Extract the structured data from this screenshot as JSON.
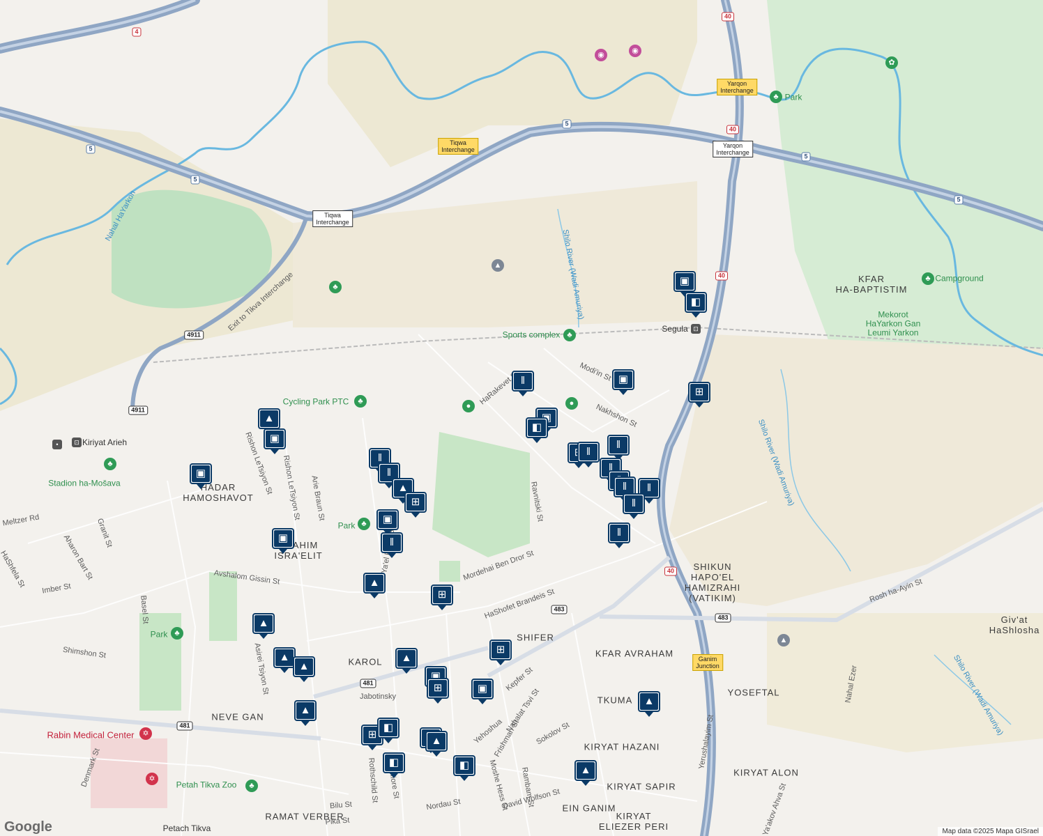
{
  "attribution": "Map data ©2025 Mapa GISrael",
  "logo": "Google",
  "colors": {
    "highway": "#8fa6c4",
    "green": "#cfe8cf",
    "water": "#69b8e0",
    "pin": "#0b3a66",
    "land": "#f3f1ed"
  },
  "neighborhoods": [
    {
      "text": "HADAR\nHAMOSHAVOT"
    },
    {
      "text": "HAAHIM\nISRA'ELIT"
    },
    {
      "text": "KAROL"
    },
    {
      "text": "SHIFER"
    },
    {
      "text": "NEVE GAN"
    },
    {
      "text": "KFAR AVRAHAM"
    },
    {
      "text": "TKUMA"
    },
    {
      "text": "YOSEFTAL"
    },
    {
      "text": "KIRYAT HAZANI"
    },
    {
      "text": "KIRYAT ALON"
    },
    {
      "text": "KIRYAT SAPIR"
    },
    {
      "text": "EIN GANIM"
    },
    {
      "text": "RAMAT VERBER"
    },
    {
      "text": "KIRYAT\nELIEZER PERI"
    },
    {
      "text": "SHIKUN\nHAPO'EL\nHAMIZRAHI\n(VATIKIM)"
    },
    {
      "text": "KFAR\nHA-BAPTISTIM"
    },
    {
      "text": "Giv'at\nHaShlosha"
    }
  ],
  "streets": [
    "Rishon LeTsiyon St",
    "Arie Braun St",
    "Mordehai Ben Dror St",
    "Ravnitski St",
    "HaShofet Brandeis St",
    "Avshalom Gissin St",
    "Imber St",
    "Aharon Bart St",
    "Granit St",
    "Basel St",
    "Shimshon St",
    "Asirei Tsiyon St",
    "Nakhshon St",
    "Modi'in St",
    "HaRakevet St",
    "Rosh ha-Ayin St",
    "Yerushalayim St",
    "Sokolov St",
    "Rambam St",
    "Nahalat Tsvi St",
    "Frishman St",
    "Moshe Hess St",
    "David Wolfson St",
    "Nordau St",
    "Pika St",
    "Bilu St",
    "Rothschild St",
    "Montefiore St",
    "Denmark St",
    "Ya'akov Ahva St",
    "Nahal Ezer",
    "Exit to Tikva Interchange",
    "Ya'el Ro'itz St",
    "Rishon LeTsiyon St",
    "Jabotinsky",
    "Yehoshua",
    "Kepfer St",
    "Meltzer Rd",
    "HaShfela St"
  ],
  "water_labels": [
    "Nahal HaYarkon",
    "Shilo River (Wadi Amuriya)",
    "Shilo River (Wadi Amuriya)",
    "Shilo River (Wadi Amuriya)"
  ],
  "places": {
    "green": [
      "Cycling Park PTC",
      "Sports complex",
      "Park",
      "Park",
      "Park",
      "Petah Tikva Zoo",
      "Stadion ha-Mošava",
      "Campground",
      "Mekorot\nHaYarkon Gan\nLeumi Yarkon"
    ],
    "red": [
      "Rabin Medical Center"
    ],
    "dark": [
      "Kiriyat Arieh",
      "Segula",
      "Petach Tikva"
    ]
  },
  "interchanges": [
    "Tiqwa\nInterchange",
    "Tiqwa\nInterchange",
    "Yarqon\nInterchange",
    "Yarqon\nInterchange",
    "Ganim\nJunction"
  ],
  "shields": [
    "4",
    "5",
    "5",
    "5",
    "5",
    "5",
    "40",
    "40",
    "40",
    "40",
    "4911",
    "4911",
    "481",
    "481",
    "483",
    "483"
  ],
  "pins": [
    {
      "icon": "restaurant"
    },
    {
      "icon": "shopping"
    },
    {
      "icon": "shopping"
    },
    {
      "icon": "cafe"
    },
    {
      "icon": "grocery"
    },
    {
      "icon": "shopping"
    },
    {
      "icon": "cafe"
    },
    {
      "icon": "grocery"
    },
    {
      "icon": "restaurant"
    },
    {
      "icon": "restaurant"
    },
    {
      "icon": "restaurant"
    },
    {
      "icon": "restaurant"
    },
    {
      "icon": "restaurant"
    },
    {
      "icon": "restaurant"
    },
    {
      "icon": "restaurant"
    },
    {
      "icon": "school"
    },
    {
      "icon": "shopping"
    },
    {
      "icon": "shopping"
    },
    {
      "icon": "shopping"
    },
    {
      "icon": "restaurant"
    },
    {
      "icon": "restaurant"
    },
    {
      "icon": "school"
    },
    {
      "icon": "grocery"
    },
    {
      "icon": "shopping"
    },
    {
      "icon": "restaurant"
    },
    {
      "icon": "school"
    },
    {
      "icon": "grocery"
    },
    {
      "icon": "school"
    },
    {
      "icon": "school"
    },
    {
      "icon": "school"
    },
    {
      "icon": "school"
    },
    {
      "icon": "school"
    },
    {
      "icon": "grocery"
    },
    {
      "icon": "shopping"
    },
    {
      "icon": "grocery"
    },
    {
      "icon": "school"
    },
    {
      "icon": "shopping"
    },
    {
      "icon": "grocery"
    },
    {
      "icon": "cafe"
    },
    {
      "icon": "cafe"
    },
    {
      "icon": "shopping"
    },
    {
      "icon": "cafe"
    },
    {
      "icon": "school"
    },
    {
      "icon": "school"
    },
    {
      "icon": "restaurant"
    }
  ]
}
